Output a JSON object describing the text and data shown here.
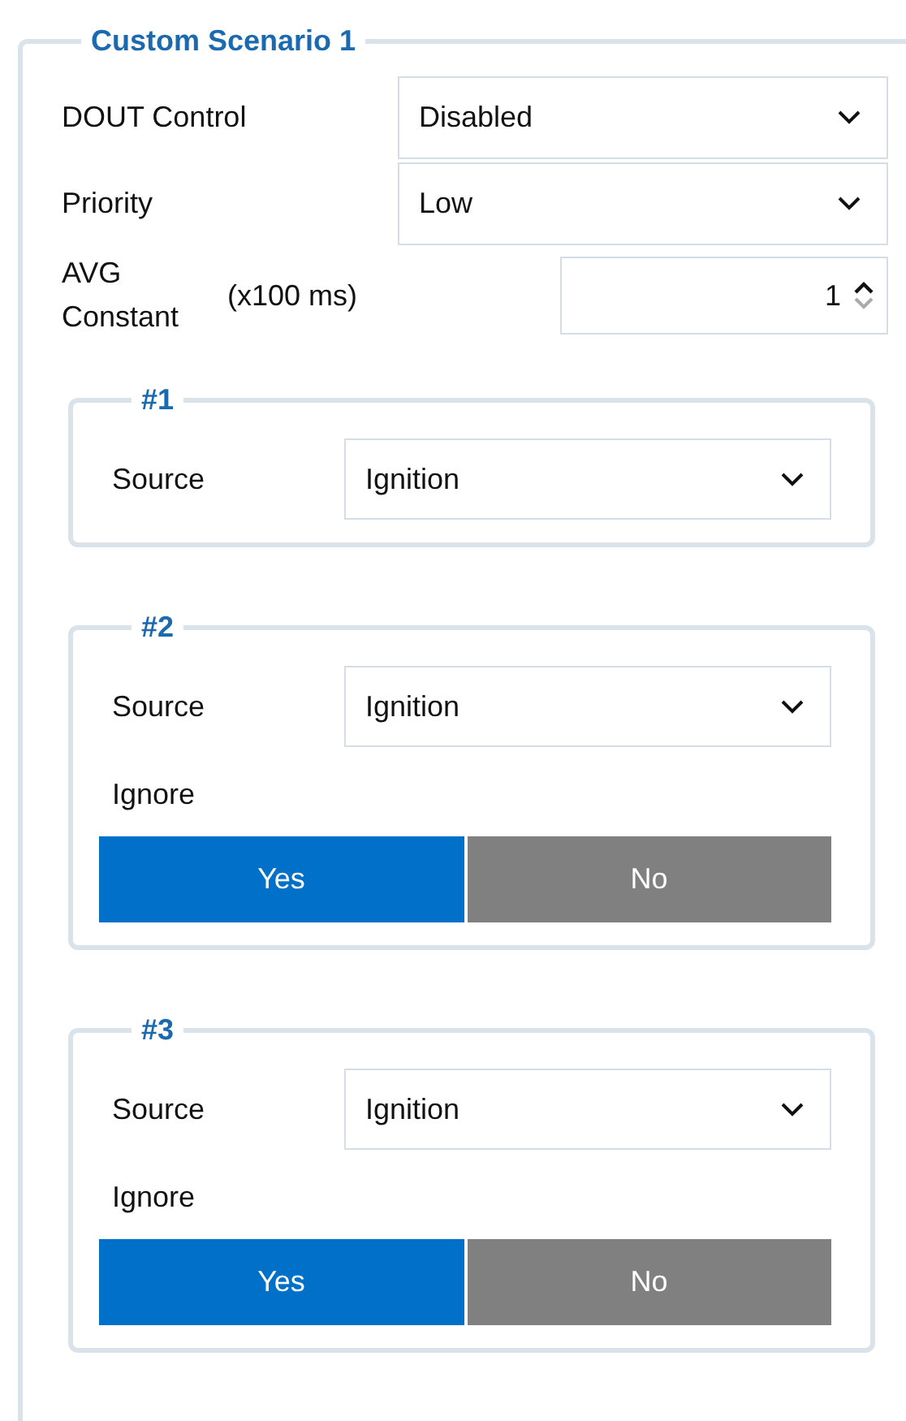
{
  "title": "Custom Scenario 1",
  "fields": [
    {
      "kind": "select",
      "label": "DOUT Control",
      "value": "Disabled"
    },
    {
      "kind": "select",
      "label": "Priority",
      "value": "Low"
    },
    {
      "kind": "spinner",
      "label": "AVG Constant",
      "unit": "(x100 ms)",
      "value": "1"
    }
  ],
  "groups": [
    {
      "title": "#1",
      "source_label": "Source",
      "source_value": "Ignition"
    },
    {
      "title": "#2",
      "source_label": "Source",
      "source_value": "Ignition",
      "ignore": {
        "label": "Ignore",
        "options": [
          {
            "label": "Yes",
            "selected": true
          },
          {
            "label": "No",
            "selected": false
          }
        ]
      }
    },
    {
      "title": "#3",
      "source_label": "Source",
      "source_value": "Ignition",
      "ignore": {
        "label": "Ignore",
        "options": [
          {
            "label": "Yes",
            "selected": true
          },
          {
            "label": "No",
            "selected": false
          }
        ]
      }
    }
  ]
}
